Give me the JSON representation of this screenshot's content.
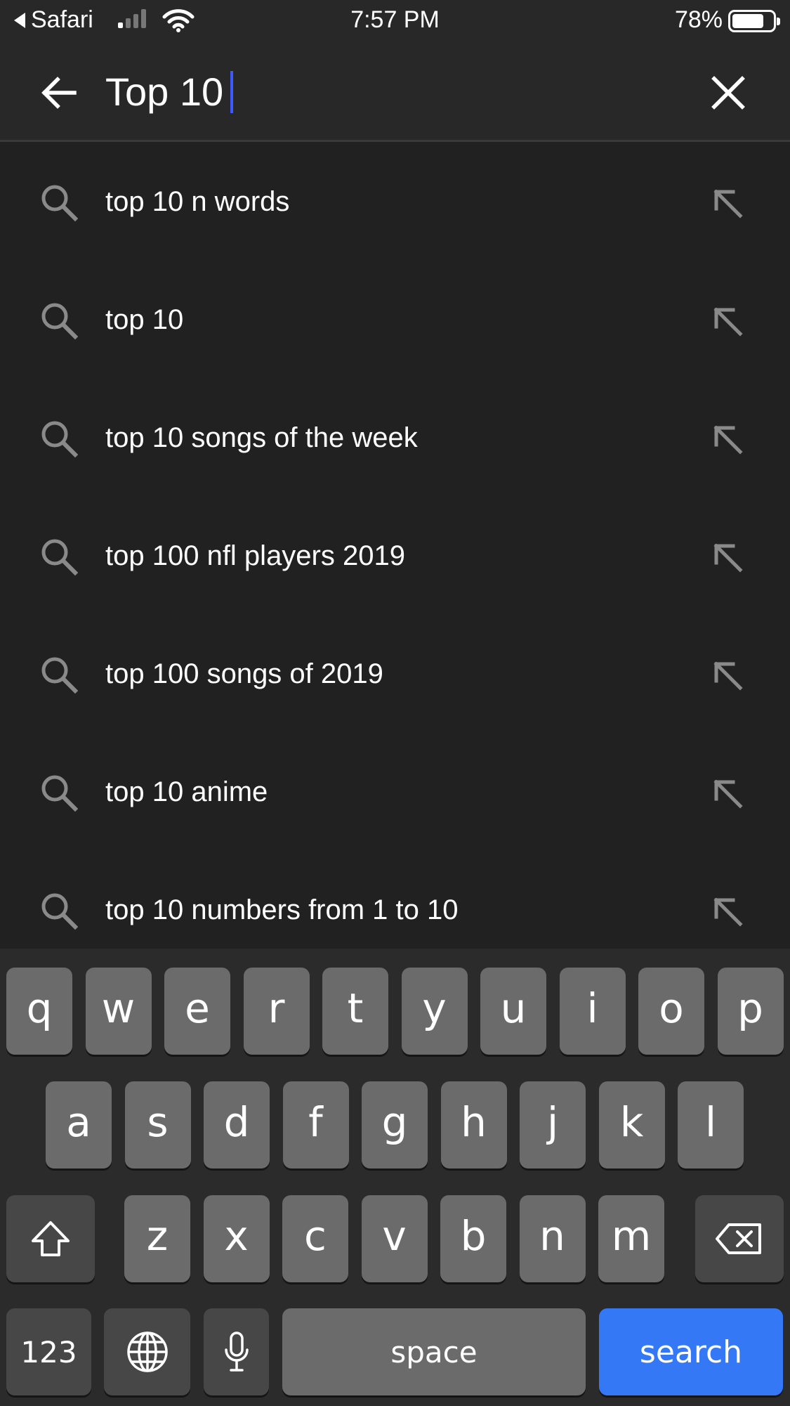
{
  "status_bar": {
    "back_app": "Safari",
    "time": "7:57 PM",
    "battery_percent": "78%",
    "battery_level": 0.78,
    "signal_bars_active": 1
  },
  "search": {
    "query": "Top 10"
  },
  "suggestions": [
    {
      "text": "top 10 n words"
    },
    {
      "text": "top 10"
    },
    {
      "text": "top 10 songs of the week"
    },
    {
      "text": "top 100 nfl players 2019"
    },
    {
      "text": "top 100 songs of 2019"
    },
    {
      "text": "top 10 anime"
    },
    {
      "text": "top 10 numbers from 1 to 10"
    }
  ],
  "keyboard": {
    "row1": [
      "q",
      "w",
      "e",
      "r",
      "t",
      "y",
      "u",
      "i",
      "o",
      "p"
    ],
    "row2": [
      "a",
      "s",
      "d",
      "f",
      "g",
      "h",
      "j",
      "k",
      "l"
    ],
    "row3": [
      "z",
      "x",
      "c",
      "v",
      "b",
      "n",
      "m"
    ],
    "numbers_label": "123",
    "space_label": "space",
    "search_label": "search"
  },
  "colors": {
    "background": "#212121",
    "header": "#282828",
    "caret": "#3d5afe",
    "search_key": "#3478f6",
    "icon_gray": "#8a8a8a"
  }
}
